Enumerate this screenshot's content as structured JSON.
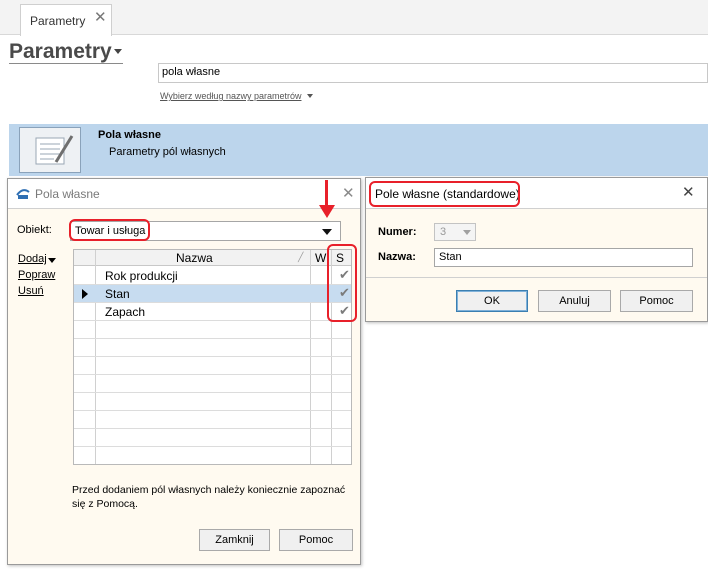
{
  "tab": {
    "label": "Parametry",
    "close": "✕"
  },
  "page": {
    "title": "Parametry",
    "search_value": "pola własne",
    "search_hint": "Wybierz według nazwy parametrów"
  },
  "result": {
    "title": "Pola własne",
    "subtitle": "Parametry pól własnych",
    "icon": "document-pen-icon"
  },
  "dialog_pola": {
    "title": "Pola własne",
    "close": "✕",
    "obiekt_label": "Obiekt:",
    "obiekt_value": "Towar i usługa",
    "actions": {
      "dodaj": "Dodaj",
      "popraw": "Popraw",
      "usun": "Usuń"
    },
    "columns": {
      "nazwa": "Nazwa",
      "w": "W",
      "s": "S"
    },
    "rows": [
      {
        "name": "Rok produkcji",
        "s_checked": "✔"
      },
      {
        "name": "Stan",
        "s_checked": "✔"
      },
      {
        "name": "Zapach",
        "s_checked": "✔"
      }
    ],
    "note": "Przed dodaniem pól własnych należy koniecznie zapoznać się z Pomocą.",
    "buttons": {
      "zamknij": "Zamknij",
      "pomoc": "Pomoc"
    }
  },
  "dialog_pole": {
    "title": "Pole własne (standardowe)",
    "close": "✕",
    "numer_label": "Numer:",
    "numer_value": "3",
    "nazwa_label": "Nazwa:",
    "nazwa_value": "Stan",
    "buttons": {
      "ok": "OK",
      "anuluj": "Anuluj",
      "pomoc": "Pomoc"
    }
  },
  "colors": {
    "annotation": "#e8202a",
    "selection": "#bcd5ec",
    "dialog_bg": "#fffaf0"
  }
}
